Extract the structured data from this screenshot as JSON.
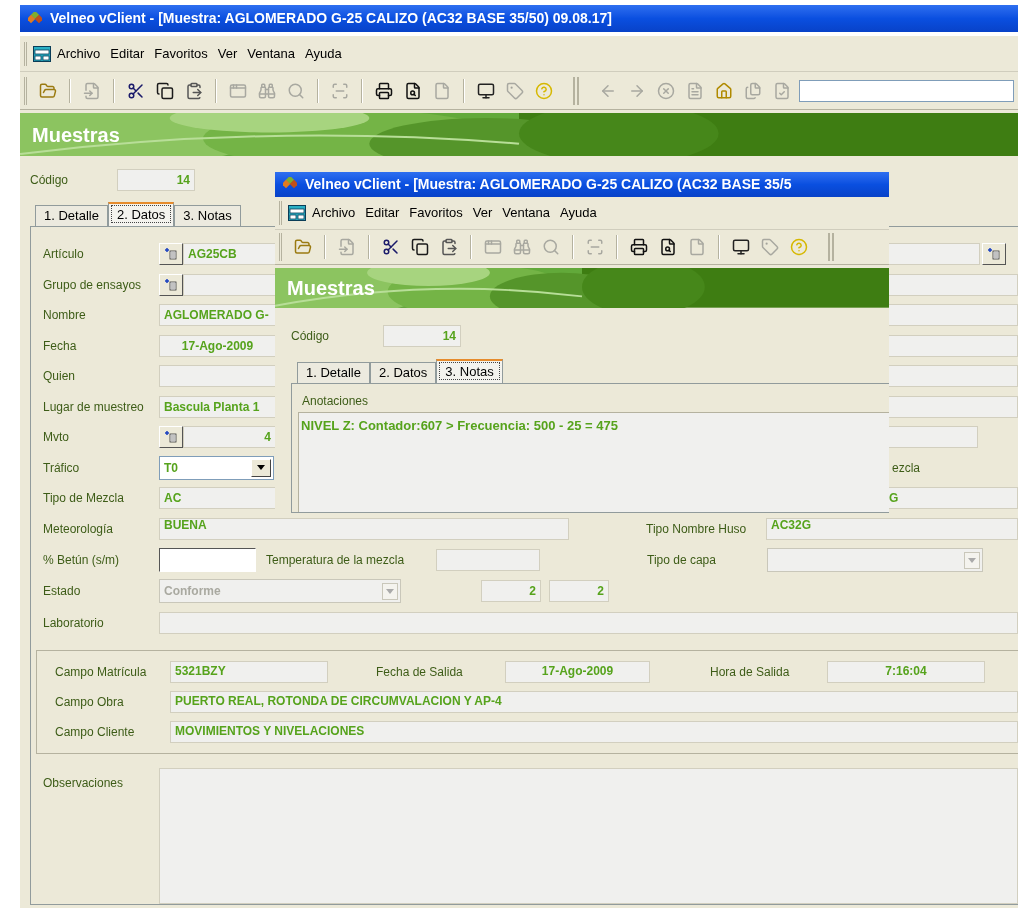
{
  "main_window": {
    "title": "Velneo vClient - [Muestra: AGLOMERADO G-25 CALIZO (AC32 BASE 35/50) 09.08.17]",
    "menu": [
      "Archivo",
      "Editar",
      "Favoritos",
      "Ver",
      "Ventana",
      "Ayuda"
    ],
    "banner": "Muestras",
    "codigo": {
      "label": "Código",
      "value": "14"
    },
    "tabs": [
      {
        "label": "1. Detalle",
        "selected": false
      },
      {
        "label": "2. Datos",
        "selected": true
      },
      {
        "label": "3. Notas",
        "selected": false
      }
    ],
    "rows": [
      {
        "label": "Artículo",
        "kind": "lookup",
        "value": "AG25CB",
        "right": {
          "button": true
        }
      },
      {
        "label": "Grupo de ensayos",
        "kind": "lookup",
        "right": {}
      },
      {
        "label": "Nombre",
        "kind": "text",
        "value": "AGLOMERADO G-",
        "right": {}
      },
      {
        "label": "Fecha",
        "kind": "date",
        "value": "17-Ago-2009",
        "right": {}
      },
      {
        "label": "Quien",
        "kind": "text",
        "right": {}
      },
      {
        "label": "Lugar de muestreo",
        "kind": "text",
        "value": "Bascula Planta 1",
        "right": {}
      },
      {
        "label": "Mvto",
        "kind": "lookup_number",
        "value": "4",
        "right": {
          "short": true
        }
      },
      {
        "label": "Tráfico",
        "kind": "combo",
        "value": "T0",
        "right": {
          "label": "ezcla"
        }
      },
      {
        "label": "Tipo de Mezcla",
        "kind": "text",
        "value": "AC",
        "right": {
          "value": "G"
        }
      }
    ],
    "meteorologia": {
      "label": "Meteorología",
      "value": "BUENA"
    },
    "tipo_nombre_huso": {
      "label": "Tipo Nombre Huso",
      "value": "AC32G"
    },
    "betun": {
      "label": "% Betún (s/m)"
    },
    "temperatura": {
      "label": "Temperatura de la mezcla"
    },
    "tipo_capa": {
      "label": "Tipo de capa",
      "disabled": true
    },
    "estado": {
      "label": "Estado",
      "value": "Conforme",
      "disabled": true
    },
    "counters": [
      "2",
      "2"
    ],
    "laboratorio": {
      "label": "Laboratorio"
    },
    "salida": {
      "matricula": {
        "label": "Campo Matrícula",
        "value": "5321BZY"
      },
      "fecha": {
        "label": "Fecha de Salida",
        "value": "17-Ago-2009"
      },
      "hora": {
        "label": "Hora de Salida",
        "value": "7:16:04"
      },
      "obra": {
        "label": "Campo Obra",
        "value": "PUERTO REAL, ROTONDA DE CIRCUMVALACION Y AP-4"
      },
      "cliente": {
        "label": "Campo Cliente",
        "value": "MOVIMIENTOS Y NIVELACIONES"
      }
    },
    "observaciones": {
      "label": "Observaciones"
    }
  },
  "overlay_window": {
    "title": "Velneo vClient - [Muestra: AGLOMERADO G-25 CALIZO (AC32 BASE 35/5",
    "menu": [
      "Archivo",
      "Editar",
      "Favoritos",
      "Ver",
      "Ventana",
      "Ayuda"
    ],
    "banner": "Muestras",
    "codigo": {
      "label": "Código",
      "value": "14"
    },
    "tabs": [
      {
        "label": "1. Detalle",
        "selected": false
      },
      {
        "label": "2. Datos",
        "selected": false
      },
      {
        "label": "3. Notas",
        "selected": true
      }
    ],
    "anotaciones": {
      "label": "Anotaciones",
      "value": "NIVEL Z: Contador:607 > Frecuencia: 500 - 25 = 475"
    }
  }
}
